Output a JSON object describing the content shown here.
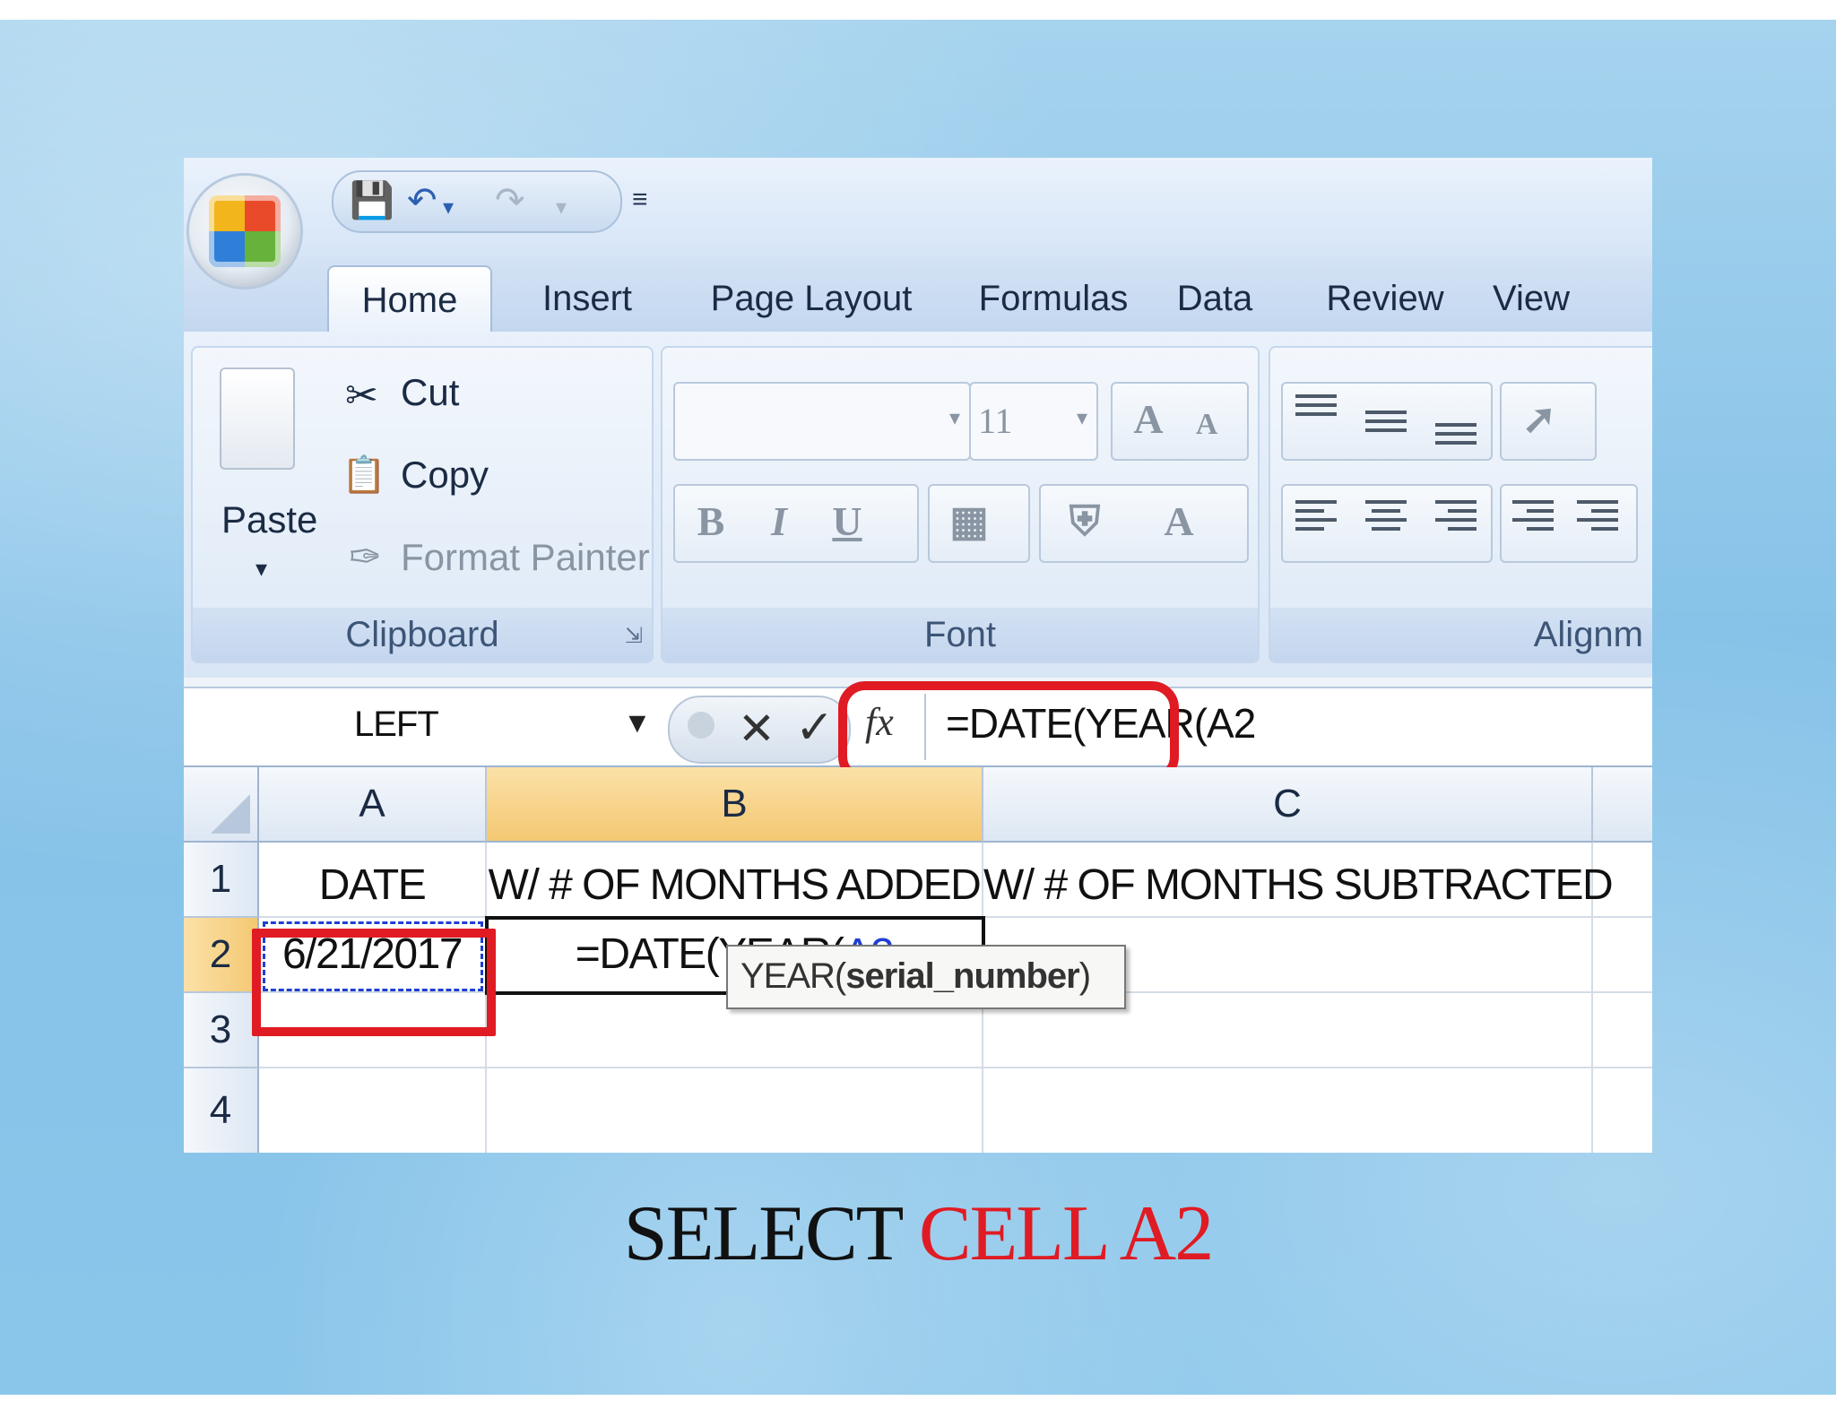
{
  "tabs": [
    "Home",
    "Insert",
    "Page Layout",
    "Formulas",
    "Data",
    "Review",
    "View"
  ],
  "active_tab": "Home",
  "clipboard": {
    "paste_label": "Paste",
    "cut_label": "Cut",
    "copy_label": "Copy",
    "format_painter_label": "Format Painter",
    "group_label": "Clipboard"
  },
  "font": {
    "font_name": "",
    "font_size": "11",
    "group_label": "Font"
  },
  "alignment": {
    "group_label": "Alignm"
  },
  "formula_bar": {
    "name_box": "LEFT",
    "fx_label": "fx",
    "formula": "=DATE(YEAR(A2"
  },
  "columns": [
    "A",
    "B",
    "C"
  ],
  "rows": [
    "1",
    "2",
    "3",
    "4"
  ],
  "cells": {
    "A1": "DATE",
    "B1": "W/ # OF MONTHS ADDED",
    "C1": "W/ # OF MONTHS SUBTRACTED",
    "A2": "6/21/2017",
    "B2_prefix": "=DATE(YEAR(",
    "B2_ref": "A2"
  },
  "tooltip": {
    "func": "YEAR(",
    "arg": "serial_number",
    "close": ")"
  },
  "caption": {
    "black": "SELECT ",
    "red": "CELL A2"
  },
  "colors": {
    "highlight_red": "#e01b23",
    "selected_header": "#f4c872",
    "reference_blue": "#1f3fd1",
    "paren_green": "#2a9a3a"
  },
  "icons": [
    "office-button-icon",
    "save-icon",
    "undo-icon",
    "redo-icon",
    "customize-qat-icon",
    "cut-icon",
    "copy-icon",
    "format-painter-icon",
    "paste-icon"
  ]
}
